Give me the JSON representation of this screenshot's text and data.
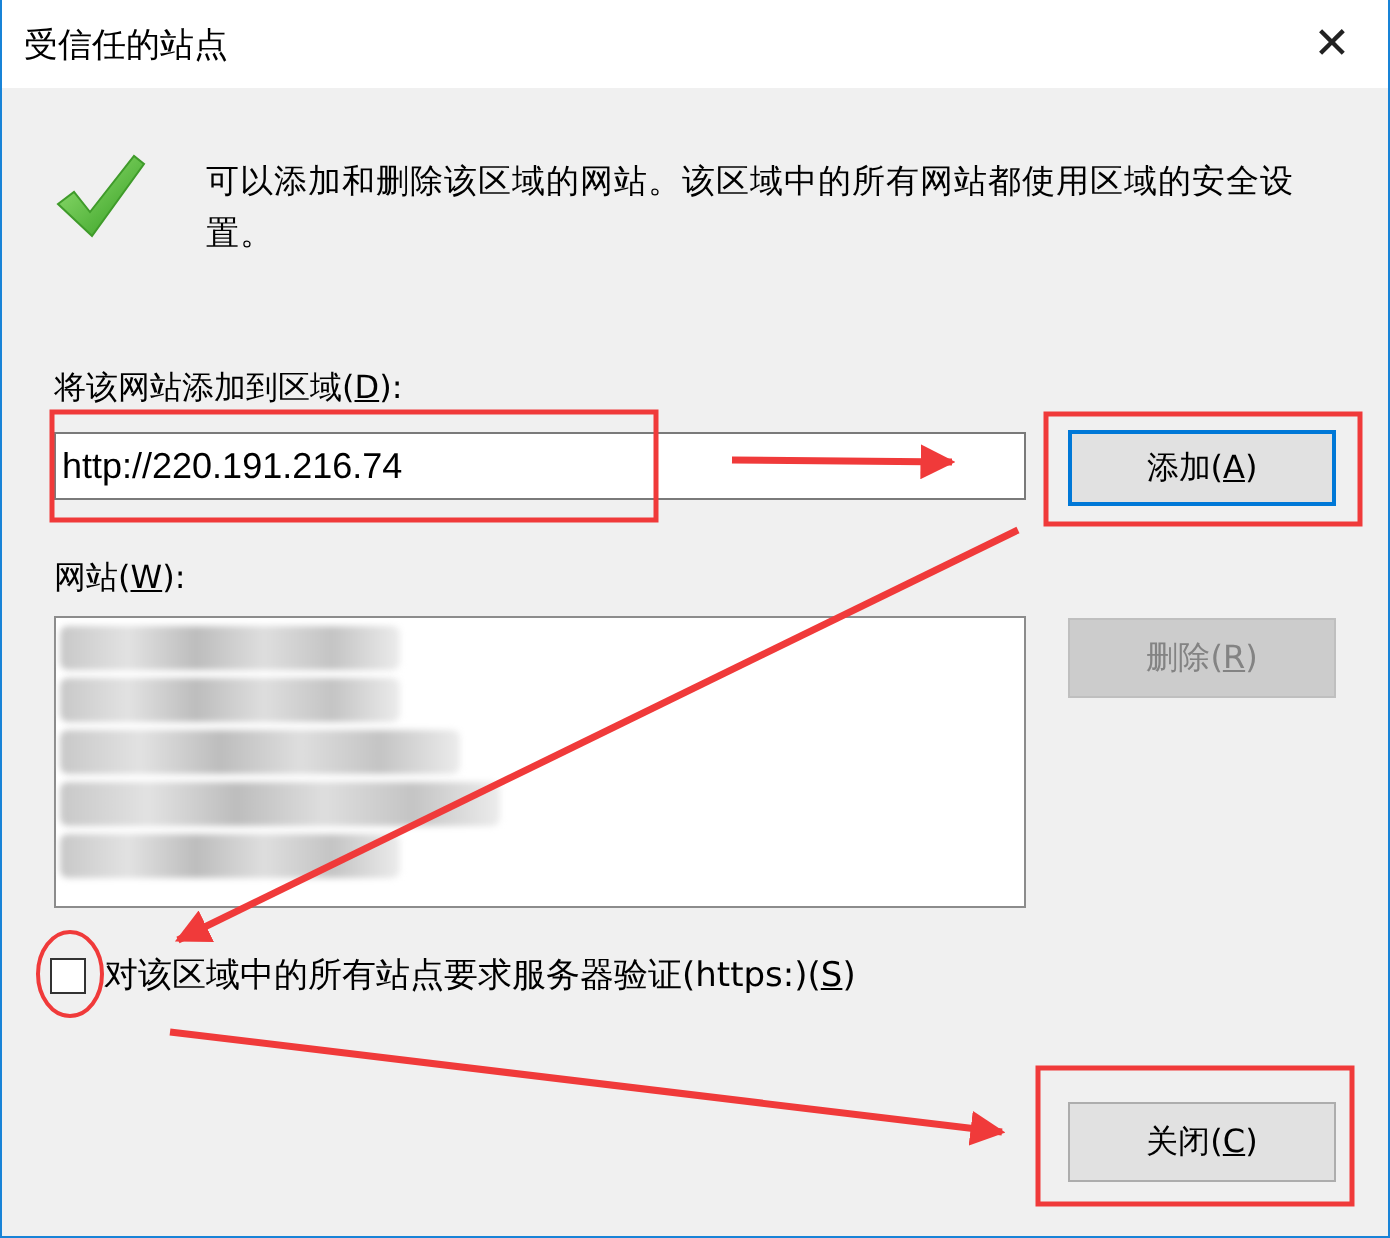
{
  "window": {
    "title": "受信任的站点",
    "close_glyph": "✕"
  },
  "info": {
    "text": "可以添加和删除该区域的网站。该区域中的所有网站都使用区域的安全设置。"
  },
  "add_field": {
    "label": "将该网站添加到区域(D):",
    "value": "http://220.191.216.74"
  },
  "add_button": {
    "label": "添加(A)",
    "disabled": false,
    "focused": true
  },
  "sites_label": {
    "label": "网站(W):"
  },
  "sites": [
    {
      "kind": "redacted"
    },
    {
      "kind": "redacted"
    },
    {
      "kind": "redacted"
    },
    {
      "kind": "redacted"
    },
    {
      "kind": "redacted"
    }
  ],
  "remove_button": {
    "label": "删除(R)",
    "disabled": true,
    "focused": false
  },
  "https_checkbox": {
    "label": "对该区域中的所有站点要求服务器验证(https:)(S)",
    "checked": false
  },
  "close_button": {
    "label": "关闭(C)",
    "disabled": false,
    "focused": false
  }
}
